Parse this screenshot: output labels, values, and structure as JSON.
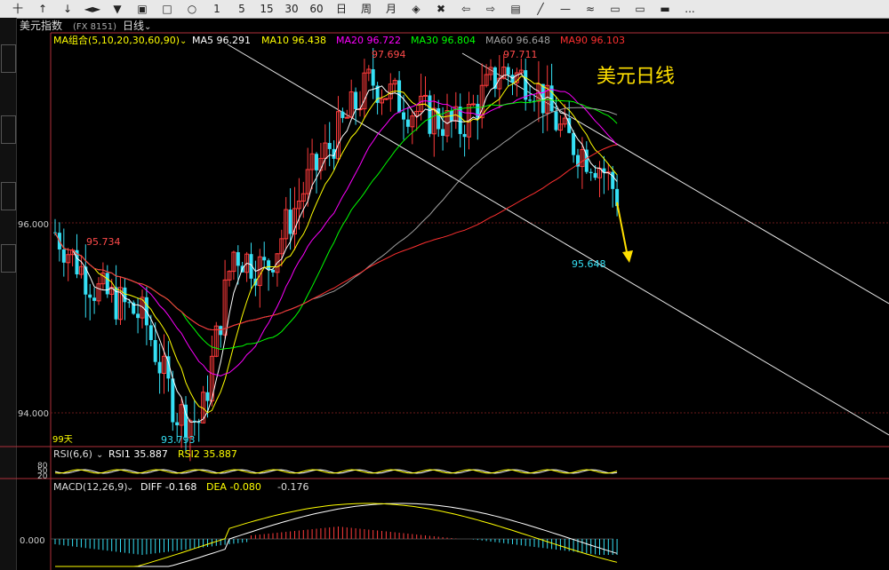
{
  "toolbar": {
    "items": [
      "十",
      "↑",
      "↓",
      "◄►",
      "▼",
      "▣",
      "□",
      "○",
      "1",
      "5",
      "15",
      "30",
      "60",
      "日",
      "周",
      "月",
      "◈",
      "✖",
      "⇦",
      "⇨",
      "▤",
      "╱",
      "—",
      "≈",
      "▭",
      "▭",
      "▬",
      "..."
    ]
  },
  "title": {
    "symbol": "美元指数",
    "code": "(FX 8151)",
    "period": "日线"
  },
  "ma_legend": {
    "group": "MA组合(5,10,20,30,60,90)",
    "ma5": "MA5 96.291",
    "ma10": "MA10 96.438",
    "ma20": "MA20 96.722",
    "ma30": "MA30 96.804",
    "ma60": "MA60 96.648",
    "ma90": "MA90 96.103"
  },
  "price_labels": {
    "high1": "97.694",
    "high2": "97.711",
    "left_high": "95.734",
    "recent_low": "95.648",
    "bottom_low": "93.793",
    "axis_96": "96.000",
    "axis_94": "94.000",
    "days": "99天"
  },
  "annotation": "美元日线",
  "rsi": {
    "title": "RSI(6,6)",
    "rsi1": "RSI1 35.887",
    "rsi2": "RSI2 35.887",
    "axis_80": "80",
    "axis_50": "50",
    "axis_20": "20"
  },
  "macd": {
    "title": "MACD(12,26,9)",
    "diff": "DIFF -0.168",
    "dea": "DEA -0.080",
    "macd_val": "-0.176",
    "axis_0": "0.000"
  },
  "colors": {
    "up": "#ff3b3b",
    "down": "#35e0f5",
    "ma5": "#ffffff",
    "ma10": "#ffff00",
    "ma20": "#ff00ff",
    "ma30": "#00ff00",
    "ma60": "#a0a0a0",
    "ma90": "#ff3030",
    "annotation": "#ffe000"
  }
}
